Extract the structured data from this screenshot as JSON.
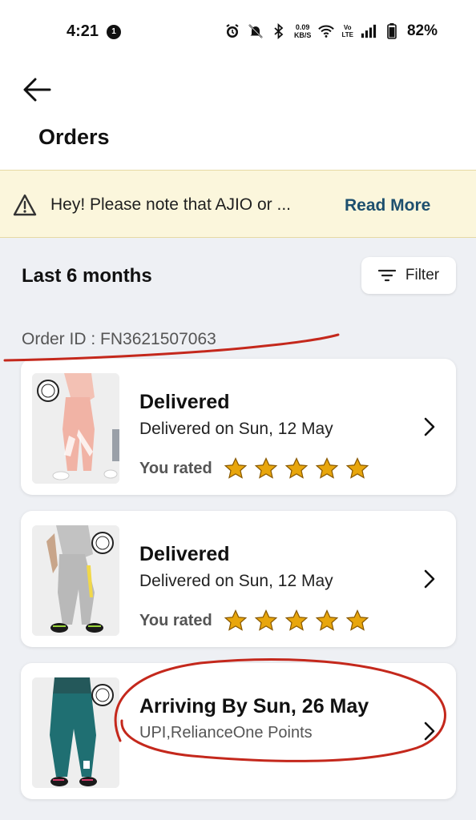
{
  "status_bar": {
    "time": "4:21",
    "notification_badge": "1",
    "net_speed_value": "0.09",
    "net_speed_unit": "KB/S",
    "volte_top": "Vo",
    "volte_bottom": "LTE",
    "battery": "82%",
    "icons": [
      "alarm-icon",
      "silent-icon",
      "bluetooth-icon",
      "wifi-icon",
      "signal-icon",
      "battery-icon"
    ]
  },
  "header": {
    "title": "Orders"
  },
  "notice": {
    "text": "Hey! Please note that AJIO or ...",
    "link": "Read More"
  },
  "orders_section": {
    "period": "Last 6 months",
    "filter_label": "Filter",
    "order_id": "Order ID : FN3621507063"
  },
  "items": [
    {
      "status": "Delivered",
      "detail": "Delivered on Sun, 12 May",
      "rated_label": "You rated",
      "rating": 5,
      "product_color": "#f1b3a5"
    },
    {
      "status": "Delivered",
      "detail": "Delivered on Sun, 12 May",
      "rated_label": "You rated",
      "rating": 5,
      "product_color": "#b9b9b9"
    },
    {
      "status": "Arriving By Sun, 26 May",
      "detail": "UPI,RelianceOne Points",
      "product_color": "#1f6f72"
    }
  ],
  "colors": {
    "accent_link": "#1d4f6e",
    "star": "#e8a60c",
    "annotation": "#c4281c",
    "notice_bg": "#fbf6dc"
  }
}
